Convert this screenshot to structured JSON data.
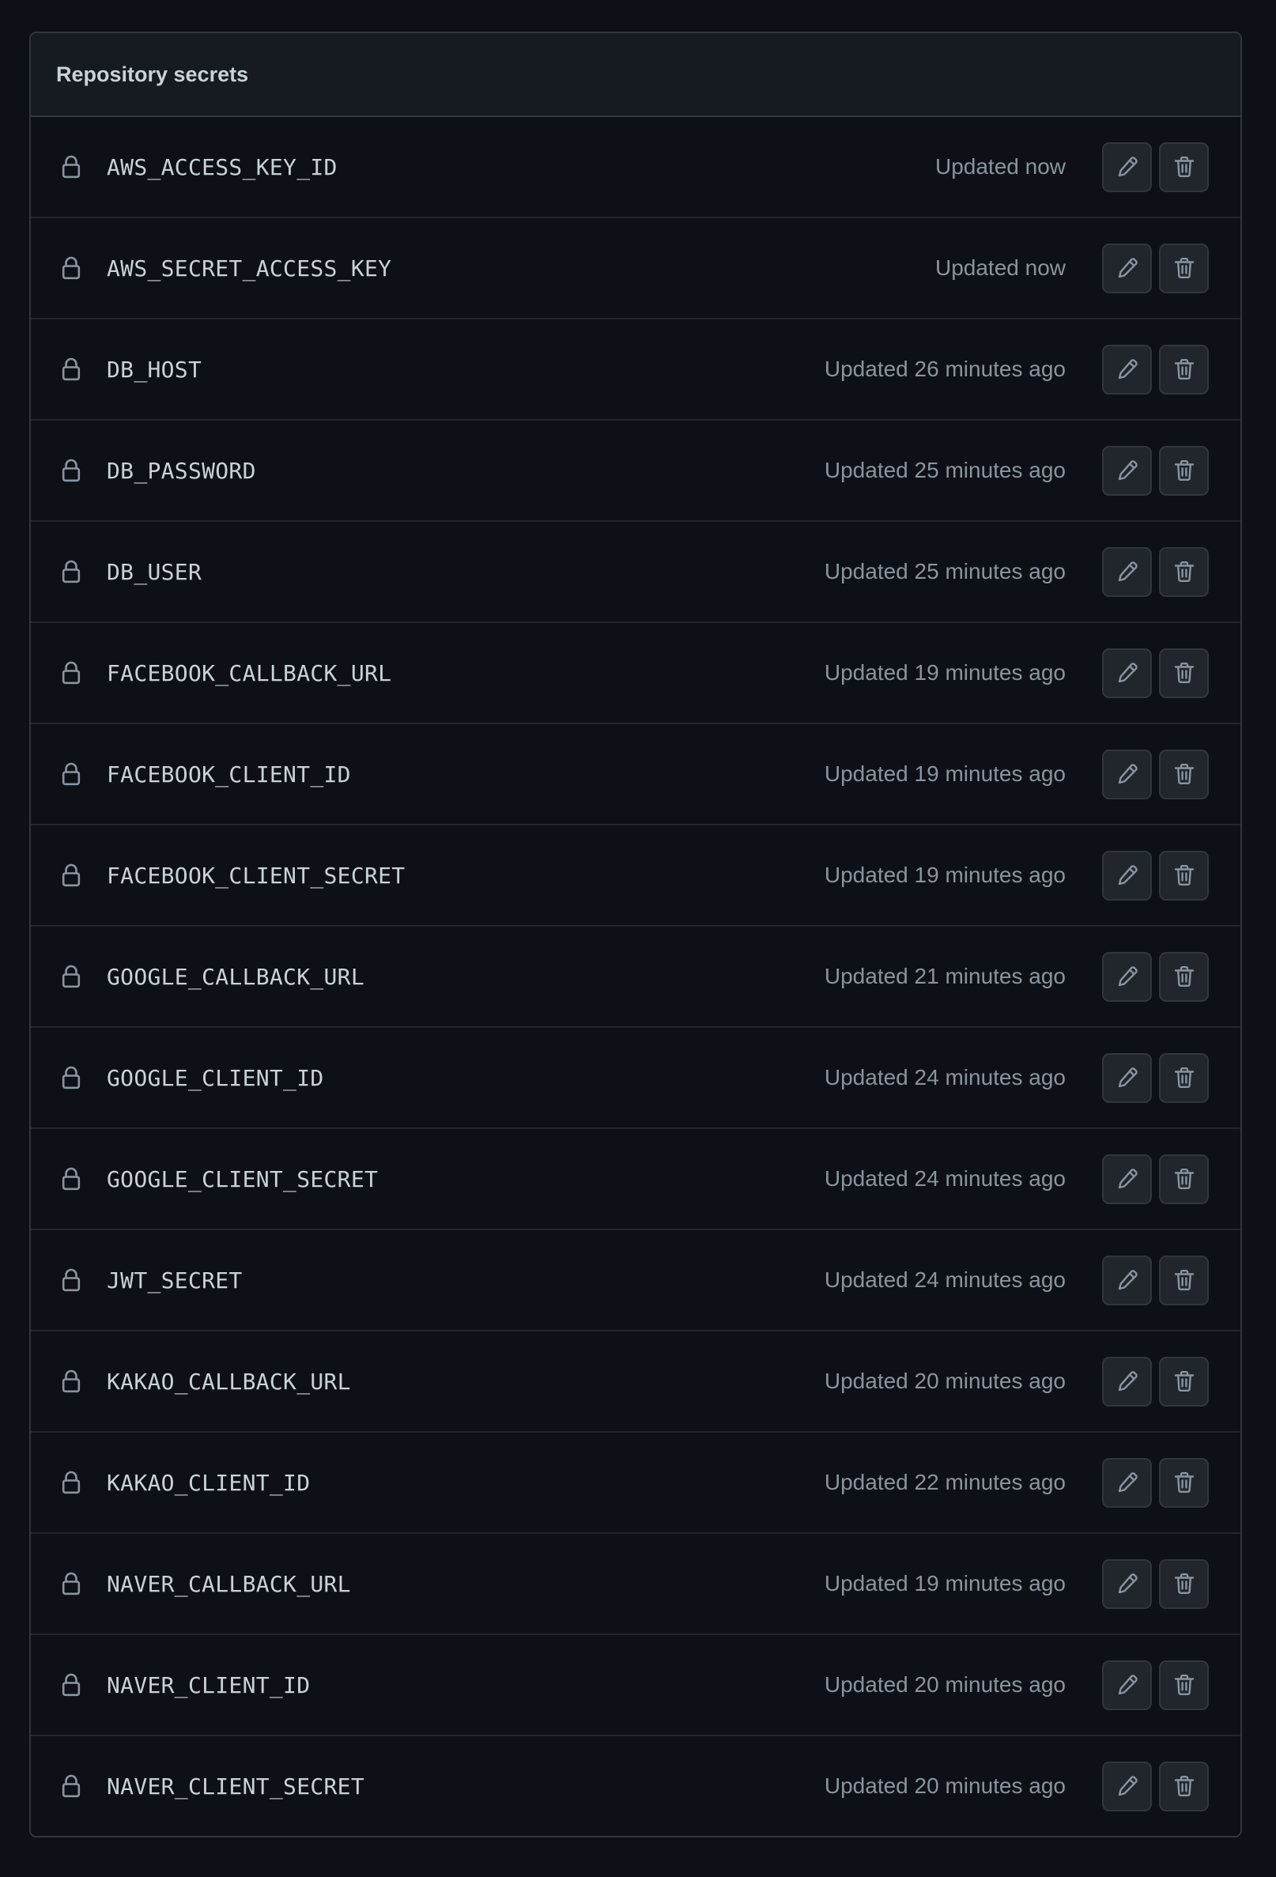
{
  "panel": {
    "title": "Repository secrets"
  },
  "secrets": [
    {
      "name": "AWS_ACCESS_KEY_ID",
      "updated": "Updated now"
    },
    {
      "name": "AWS_SECRET_ACCESS_KEY",
      "updated": "Updated now"
    },
    {
      "name": "DB_HOST",
      "updated": "Updated 26 minutes ago"
    },
    {
      "name": "DB_PASSWORD",
      "updated": "Updated 25 minutes ago"
    },
    {
      "name": "DB_USER",
      "updated": "Updated 25 minutes ago"
    },
    {
      "name": "FACEBOOK_CALLBACK_URL",
      "updated": "Updated 19 minutes ago"
    },
    {
      "name": "FACEBOOK_CLIENT_ID",
      "updated": "Updated 19 minutes ago"
    },
    {
      "name": "FACEBOOK_CLIENT_SECRET",
      "updated": "Updated 19 minutes ago"
    },
    {
      "name": "GOOGLE_CALLBACK_URL",
      "updated": "Updated 21 minutes ago"
    },
    {
      "name": "GOOGLE_CLIENT_ID",
      "updated": "Updated 24 minutes ago"
    },
    {
      "name": "GOOGLE_CLIENT_SECRET",
      "updated": "Updated 24 minutes ago"
    },
    {
      "name": "JWT_SECRET",
      "updated": "Updated 24 minutes ago"
    },
    {
      "name": "KAKAO_CALLBACK_URL",
      "updated": "Updated 20 minutes ago"
    },
    {
      "name": "KAKAO_CLIENT_ID",
      "updated": "Updated 22 minutes ago"
    },
    {
      "name": "NAVER_CALLBACK_URL",
      "updated": "Updated 19 minutes ago"
    },
    {
      "name": "NAVER_CLIENT_ID",
      "updated": "Updated 20 minutes ago"
    },
    {
      "name": "NAVER_CLIENT_SECRET",
      "updated": "Updated 20 minutes ago"
    }
  ],
  "icons": {
    "row_icon": "lock-icon",
    "edit_icon": "pencil-icon",
    "delete_icon": "trash-icon"
  },
  "colors": {
    "background": "#0d1117",
    "header_background": "#161b22",
    "border": "#30363d",
    "text": "#c9d1d9",
    "muted_text": "#8b949e",
    "button_background": "#21262d"
  }
}
